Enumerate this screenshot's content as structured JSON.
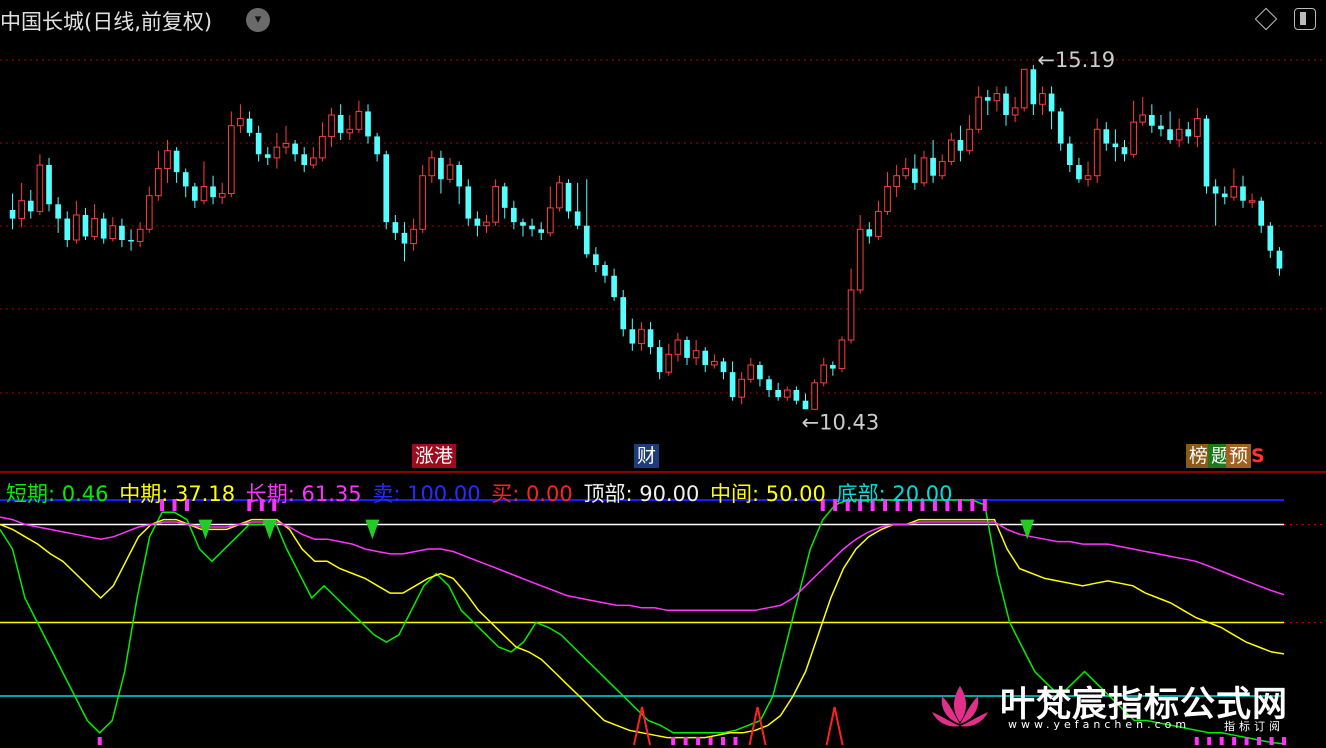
{
  "title": "中国长城(日线,前复权)",
  "icons": {
    "dropdown": "chevron-down-icon",
    "diamond": "diamond-icon",
    "layout": "layout-icon"
  },
  "colors": {
    "up": "#ff3c3c",
    "down": "#54ffff",
    "grid": "#b00000"
  },
  "tags": {
    "t1": "涨港",
    "t2": "财",
    "t3": "榜",
    "t4": "题",
    "t5": "预",
    "t6": "S"
  },
  "legend": {
    "short": "短期: 0.46",
    "mid": "中期: 37.18",
    "long": "长期: 61.35",
    "sell": "卖: 100.00",
    "buy": "买: 0.00",
    "top": "顶部: 90.00",
    "middle": "中间: 50.00",
    "bottom": "底部: 20.00"
  },
  "watermark": {
    "main": "叶梵宸指标公式网",
    "url": "www.yefanchen.com",
    "sub": "指标订阅"
  },
  "chart_data": [
    {
      "type": "candlestick",
      "title": "中国长城(日线,前复权)",
      "ylim": [
        10.0,
        15.6
      ],
      "annotations": {
        "high": "15.19",
        "low": "10.43"
      },
      "candles": [
        [
          13.22,
          13.1,
          13.45,
          12.95
        ],
        [
          13.1,
          13.35,
          13.6,
          12.98
        ],
        [
          13.35,
          13.2,
          13.5,
          13.1
        ],
        [
          13.2,
          13.85,
          14.0,
          13.15
        ],
        [
          13.85,
          13.3,
          13.95,
          13.2
        ],
        [
          13.3,
          13.1,
          13.4,
          12.9
        ],
        [
          13.1,
          12.8,
          13.2,
          12.7
        ],
        [
          12.8,
          13.15,
          13.35,
          12.75
        ],
        [
          13.15,
          12.85,
          13.25,
          12.8
        ],
        [
          12.85,
          13.1,
          13.3,
          12.8
        ],
        [
          13.1,
          12.82,
          13.18,
          12.75
        ],
        [
          12.82,
          13.0,
          13.12,
          12.78
        ],
        [
          13.0,
          12.8,
          13.1,
          12.7
        ],
        [
          12.8,
          12.78,
          12.95,
          12.65
        ],
        [
          12.78,
          12.95,
          13.05,
          12.7
        ],
        [
          12.95,
          13.42,
          13.55,
          12.9
        ],
        [
          13.42,
          13.8,
          14.05,
          13.35
        ],
        [
          13.8,
          14.05,
          14.2,
          13.6
        ],
        [
          14.05,
          13.75,
          14.1,
          13.6
        ],
        [
          13.75,
          13.55,
          13.8,
          13.4
        ],
        [
          13.55,
          13.35,
          13.6,
          13.25
        ],
        [
          13.35,
          13.55,
          13.9,
          13.3
        ],
        [
          13.55,
          13.4,
          13.7,
          13.3
        ],
        [
          13.4,
          13.45,
          13.6,
          13.3
        ],
        [
          13.45,
          14.4,
          14.6,
          13.4
        ],
        [
          14.4,
          14.5,
          14.7,
          14.3
        ],
        [
          14.5,
          14.3,
          14.6,
          14.25
        ],
        [
          14.3,
          14.0,
          14.4,
          13.9
        ],
        [
          14.0,
          13.95,
          14.1,
          13.85
        ],
        [
          13.95,
          14.1,
          14.3,
          13.8
        ],
        [
          14.1,
          14.15,
          14.4,
          14.0
        ],
        [
          14.15,
          14.0,
          14.2,
          13.9
        ],
        [
          14.0,
          13.85,
          14.1,
          13.75
        ],
        [
          13.85,
          13.95,
          14.1,
          13.8
        ],
        [
          13.95,
          14.25,
          14.45,
          13.9
        ],
        [
          14.25,
          14.55,
          14.65,
          14.1
        ],
        [
          14.55,
          14.3,
          14.7,
          14.2
        ],
        [
          14.3,
          14.35,
          14.55,
          14.2
        ],
        [
          14.35,
          14.6,
          14.75,
          14.3
        ],
        [
          14.6,
          14.25,
          14.7,
          14.15
        ],
        [
          14.25,
          14.0,
          14.3,
          13.9
        ],
        [
          14.0,
          13.05,
          14.05,
          12.95
        ],
        [
          13.05,
          12.9,
          13.15,
          12.8
        ],
        [
          12.9,
          12.75,
          13.05,
          12.5
        ],
        [
          12.75,
          12.95,
          13.1,
          12.65
        ],
        [
          12.95,
          13.7,
          13.85,
          12.9
        ],
        [
          13.7,
          13.95,
          14.05,
          13.6
        ],
        [
          13.95,
          13.65,
          14.05,
          13.45
        ],
        [
          13.65,
          13.85,
          13.95,
          13.6
        ],
        [
          13.85,
          13.55,
          13.9,
          13.3
        ],
        [
          13.55,
          13.1,
          13.65,
          13.0
        ],
        [
          13.1,
          13.0,
          13.2,
          12.85
        ],
        [
          13.0,
          13.05,
          13.15,
          12.9
        ],
        [
          13.05,
          13.55,
          13.65,
          13.0
        ],
        [
          13.55,
          13.25,
          13.6,
          13.1
        ],
        [
          13.25,
          13.05,
          13.35,
          12.95
        ],
        [
          13.05,
          13.0,
          13.1,
          12.85
        ],
        [
          13.0,
          12.95,
          13.1,
          12.85
        ],
        [
          12.95,
          12.9,
          13.05,
          12.8
        ],
        [
          12.9,
          13.25,
          13.55,
          12.85
        ],
        [
          13.25,
          13.6,
          13.7,
          13.2
        ],
        [
          13.6,
          13.2,
          13.65,
          13.1
        ],
        [
          13.2,
          13.0,
          13.6,
          12.95
        ],
        [
          13.0,
          12.6,
          13.65,
          12.55
        ],
        [
          12.6,
          12.45,
          12.7,
          12.35
        ],
        [
          12.45,
          12.3,
          12.5,
          12.2
        ],
        [
          12.3,
          12.0,
          12.4,
          11.95
        ],
        [
          12.0,
          11.55,
          12.1,
          11.45
        ],
        [
          11.55,
          11.35,
          11.7,
          11.25
        ],
        [
          11.35,
          11.55,
          11.65,
          11.25
        ],
        [
          11.55,
          11.3,
          11.65,
          11.2
        ],
        [
          11.3,
          10.95,
          11.4,
          10.85
        ],
        [
          10.95,
          11.2,
          11.35,
          10.9
        ],
        [
          11.2,
          11.4,
          11.5,
          11.1
        ],
        [
          11.4,
          11.15,
          11.45,
          11.05
        ],
        [
          11.15,
          11.25,
          11.4,
          11.05
        ],
        [
          11.25,
          11.05,
          11.3,
          10.95
        ],
        [
          11.05,
          11.1,
          11.2,
          11.0
        ],
        [
          11.1,
          10.95,
          11.15,
          10.85
        ],
        [
          10.95,
          10.6,
          11.1,
          10.55
        ],
        [
          10.6,
          10.85,
          10.95,
          10.5
        ],
        [
          10.85,
          11.05,
          11.15,
          10.8
        ],
        [
          11.05,
          10.85,
          11.1,
          10.75
        ],
        [
          10.85,
          10.7,
          10.9,
          10.6
        ],
        [
          10.7,
          10.6,
          10.8,
          10.55
        ],
        [
          10.6,
          10.7,
          10.75,
          10.55
        ],
        [
          10.7,
          10.55,
          10.75,
          10.5
        ],
        [
          10.55,
          10.43,
          10.65,
          10.43
        ],
        [
          10.43,
          10.8,
          10.85,
          10.43
        ],
        [
          10.8,
          11.05,
          11.15,
          10.75
        ],
        [
          11.05,
          11.0,
          11.1,
          10.9
        ],
        [
          11.0,
          11.4,
          11.45,
          10.95
        ],
        [
          11.4,
          12.1,
          12.4,
          11.35
        ],
        [
          12.1,
          12.95,
          13.15,
          12.05
        ],
        [
          12.95,
          12.85,
          13.05,
          12.75
        ],
        [
          12.85,
          13.2,
          13.35,
          12.8
        ],
        [
          13.2,
          13.55,
          13.75,
          13.15
        ],
        [
          13.55,
          13.7,
          13.85,
          13.4
        ],
        [
          13.7,
          13.8,
          13.95,
          13.65
        ],
        [
          13.8,
          13.6,
          14.0,
          13.5
        ],
        [
          13.6,
          13.95,
          14.05,
          13.55
        ],
        [
          13.95,
          13.7,
          14.2,
          13.6
        ],
        [
          13.7,
          13.9,
          14.0,
          13.65
        ],
        [
          13.9,
          14.2,
          14.3,
          13.85
        ],
        [
          14.2,
          14.05,
          14.4,
          13.9
        ],
        [
          14.05,
          14.35,
          14.55,
          14.0
        ],
        [
          14.35,
          14.8,
          14.95,
          14.3
        ],
        [
          14.8,
          14.75,
          14.9,
          14.55
        ],
        [
          14.75,
          14.85,
          14.95,
          14.6
        ],
        [
          14.85,
          14.55,
          14.95,
          14.4
        ],
        [
          14.55,
          14.65,
          14.8,
          14.45
        ],
        [
          14.65,
          15.19,
          15.19,
          14.6
        ],
        [
          15.19,
          14.7,
          15.25,
          14.55
        ],
        [
          14.7,
          14.85,
          14.95,
          14.55
        ],
        [
          14.85,
          14.6,
          14.95,
          14.35
        ],
        [
          14.6,
          14.15,
          14.65,
          14.05
        ],
        [
          14.15,
          13.85,
          14.25,
          13.75
        ],
        [
          13.85,
          13.65,
          13.95,
          13.6
        ],
        [
          13.65,
          13.7,
          13.9,
          13.55
        ],
        [
          13.7,
          14.35,
          14.5,
          13.6
        ],
        [
          14.35,
          14.15,
          14.45,
          14.05
        ],
        [
          14.15,
          14.1,
          14.35,
          13.9
        ],
        [
          14.1,
          14.0,
          14.2,
          13.9
        ],
        [
          14.0,
          14.45,
          14.75,
          13.95
        ],
        [
          14.45,
          14.55,
          14.8,
          14.4
        ],
        [
          14.55,
          14.4,
          14.7,
          14.3
        ],
        [
          14.4,
          14.35,
          14.55,
          14.25
        ],
        [
          14.35,
          14.2,
          14.6,
          14.15
        ],
        [
          14.2,
          14.35,
          14.5,
          14.1
        ],
        [
          14.35,
          14.25,
          14.45,
          14.15
        ],
        [
          14.25,
          14.5,
          14.65,
          14.1
        ],
        [
          14.5,
          13.55,
          14.55,
          13.45
        ],
        [
          13.55,
          13.45,
          13.65,
          13.0
        ],
        [
          13.45,
          13.4,
          13.55,
          13.3
        ],
        [
          13.4,
          13.55,
          13.8,
          13.35
        ],
        [
          13.55,
          13.35,
          13.7,
          13.25
        ],
        [
          13.35,
          13.35,
          13.45,
          13.25
        ],
        [
          13.35,
          13.0,
          13.4,
          12.9
        ],
        [
          13.0,
          12.65,
          13.05,
          12.55
        ],
        [
          12.65,
          12.4,
          12.7,
          12.3
        ]
      ]
    },
    {
      "type": "line",
      "title": "",
      "ylim": [
        0,
        100
      ],
      "levels": {
        "top": 90,
        "middle": 50,
        "bottom": 20
      },
      "series": [
        {
          "name": "短期",
          "color": "#00ee00",
          "values": [
            88,
            80,
            60,
            50,
            40,
            30,
            20,
            10,
            5,
            10,
            30,
            60,
            85,
            95,
            95,
            92,
            80,
            75,
            80,
            85,
            90,
            90,
            92,
            80,
            70,
            60,
            65,
            60,
            55,
            50,
            45,
            42,
            45,
            55,
            65,
            70,
            65,
            55,
            50,
            45,
            40,
            38,
            42,
            50,
            48,
            45,
            40,
            35,
            30,
            25,
            20,
            15,
            10,
            8,
            5,
            5,
            5,
            5,
            5,
            6,
            8,
            10,
            20,
            40,
            60,
            80,
            92,
            98,
            100,
            100,
            100,
            100,
            100,
            100,
            100,
            100,
            100,
            100,
            100,
            98,
            70,
            50,
            40,
            30,
            25,
            20,
            25,
            30,
            25,
            20,
            15,
            10,
            10,
            9,
            8,
            7,
            6,
            5,
            5,
            4,
            3,
            2,
            1,
            0.46
          ]
        },
        {
          "name": "中期",
          "color": "#ffff00",
          "values": [
            90,
            88,
            85,
            82,
            78,
            75,
            70,
            65,
            60,
            65,
            75,
            85,
            90,
            92,
            92,
            90,
            88,
            88,
            88,
            90,
            92,
            92,
            92,
            88,
            80,
            75,
            75,
            72,
            70,
            68,
            65,
            62,
            62,
            65,
            68,
            70,
            68,
            62,
            55,
            50,
            45,
            40,
            38,
            35,
            30,
            25,
            20,
            15,
            10,
            8,
            6,
            5,
            4,
            3,
            3,
            3,
            3,
            4,
            5,
            5,
            6,
            8,
            12,
            20,
            30,
            45,
            60,
            72,
            80,
            85,
            88,
            90,
            90,
            92,
            92,
            92,
            92,
            92,
            92,
            92,
            80,
            72,
            70,
            68,
            67,
            66,
            65,
            66,
            67,
            66,
            65,
            62,
            60,
            58,
            55,
            52,
            50,
            48,
            45,
            42,
            40,
            38,
            37.18
          ]
        },
        {
          "name": "长期",
          "color": "#ff33ff",
          "values": [
            93,
            92,
            90,
            89,
            88,
            87,
            86,
            85,
            84,
            85,
            87,
            89,
            90,
            91,
            91,
            90,
            89,
            89,
            89,
            90,
            91,
            91,
            91,
            89,
            86,
            84,
            84,
            83,
            82,
            80,
            79,
            78,
            78,
            79,
            80,
            80,
            79,
            77,
            75,
            73,
            71,
            69,
            67,
            65,
            63,
            61,
            60,
            59,
            58,
            57,
            57,
            56,
            56,
            55,
            55,
            55,
            55,
            55,
            55,
            55,
            55,
            56,
            57,
            60,
            65,
            70,
            75,
            80,
            84,
            87,
            89,
            90,
            90,
            91,
            91,
            91,
            91,
            91,
            91,
            91,
            88,
            86,
            85,
            84,
            83,
            83,
            82,
            82,
            82,
            81,
            80,
            79,
            78,
            77,
            76,
            75,
            73,
            71,
            69,
            67,
            65,
            63,
            61.35
          ]
        }
      ],
      "sell_signals": "magenta ticks at top band",
      "buy_signals": "red spikes at bottom band"
    }
  ]
}
